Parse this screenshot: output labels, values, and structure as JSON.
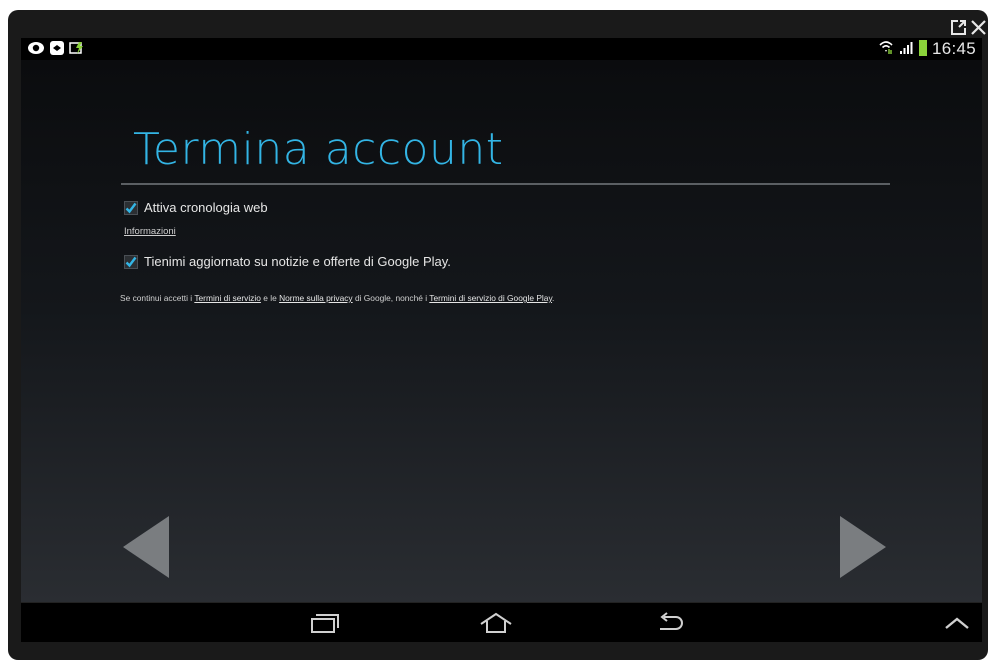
{
  "window": {
    "popout_icon": "popout-icon",
    "close_icon": "close-icon"
  },
  "statusbar": {
    "left_icons": [
      "eye-icon",
      "remote-icon",
      "battery-charge-icon"
    ],
    "time": "16:45",
    "right_icons": [
      "wifi-icon",
      "signal-icon",
      "battery-icon"
    ]
  },
  "main": {
    "title": "Termina account",
    "options": [
      {
        "label": "Attiva cronologia web",
        "checked": true
      },
      {
        "label": "Tienimi aggiornato su notizie e offerte di Google Play.",
        "checked": true
      }
    ],
    "info_link": "Informazioni",
    "terms": {
      "prefix": "Se continui accetti i ",
      "link1": "Termini di servizio",
      "mid1": " e le ",
      "link2": "Norme sulla privacy",
      "mid2": " di Google, nonché i ",
      "link3": "Termini di servizio di Google Play",
      "suffix": "."
    }
  },
  "navigation": {
    "back_arrow": "arrow-left-icon",
    "next_arrow": "arrow-right-icon",
    "buttons": [
      "recent-apps-icon",
      "home-icon",
      "back-icon",
      "chevron-up-icon"
    ]
  },
  "colors": {
    "accent": "#33b5e5",
    "checkbox": "#33b5e5",
    "arrow": "#7a7d80"
  }
}
